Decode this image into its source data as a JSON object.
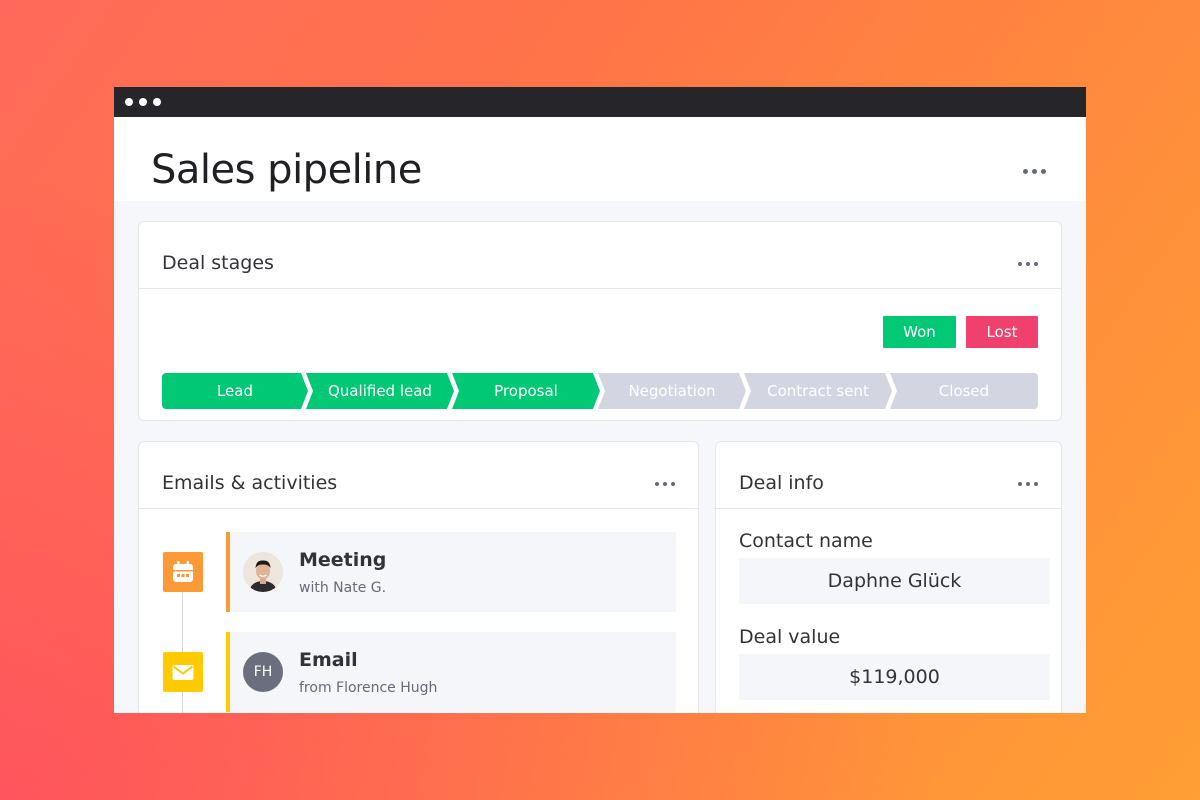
{
  "page": {
    "title": "Sales pipeline"
  },
  "deal_stages": {
    "title": "Deal stages",
    "won_label": "Won",
    "lost_label": "Lost",
    "stages": [
      {
        "label": "Lead",
        "status": "done"
      },
      {
        "label": "Qualified lead",
        "status": "done"
      },
      {
        "label": "Proposal",
        "status": "done"
      },
      {
        "label": "Negotiation",
        "status": "todo"
      },
      {
        "label": "Contract sent",
        "status": "todo"
      },
      {
        "label": "Closed",
        "status": "todo"
      }
    ]
  },
  "activities": {
    "title": "Emails & activities",
    "items": [
      {
        "type": "meeting",
        "title": "Meeting",
        "subtitle": "with Nate G.",
        "icon": "calendar-icon"
      },
      {
        "type": "email",
        "title": "Email",
        "subtitle": "from Florence Hugh",
        "avatar_initials": "FH",
        "icon": "envelope-icon"
      }
    ]
  },
  "deal_info": {
    "title": "Deal info",
    "contact_label": "Contact name",
    "contact_value": "Daphne Glück",
    "value_label": "Deal value",
    "value_value": "$119,000"
  },
  "colors": {
    "done": "#00c875",
    "todo": "#d3d5e0",
    "won": "#00c875",
    "lost": "#f0406d",
    "meeting": "#fb9a36",
    "email": "#ffcb00"
  }
}
